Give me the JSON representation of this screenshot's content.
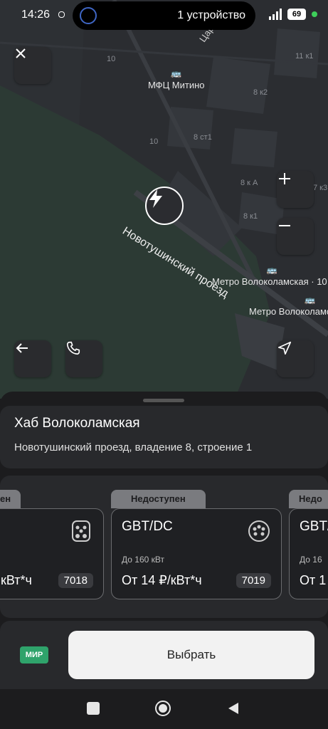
{
  "status_bar": {
    "time": "14:26",
    "device_text": "1 устройство",
    "battery": "69"
  },
  "map": {
    "labels": [
      "Цар",
      "10",
      "11 к1",
      "8 к2",
      "8 ст1",
      "10",
      "8 к А",
      "8 к1",
      "7 к3"
    ],
    "street_name": "Новотушинский проезд",
    "pois": [
      {
        "name": "МФЦ Митино"
      },
      {
        "name": "Метро Волоколамская · 10"
      },
      {
        "name": "Метро Волоколамская"
      }
    ]
  },
  "station": {
    "title": "Хаб Волоколамская",
    "address": "Новотушинский проезд, владение 8, строение 1"
  },
  "connectors": [
    {
      "status": "ен",
      "type": "",
      "power": "",
      "price": "кВт*ч",
      "id": "7018"
    },
    {
      "status": "Недоступен",
      "type": "GBT/DC",
      "power": "До 160 кВт",
      "price": "От 14 ₽/кВт*ч",
      "id": "7019"
    },
    {
      "status": "Недо",
      "type": "GBT/",
      "power": "До 16",
      "price": "От 1",
      "id": ""
    }
  ],
  "payment": {
    "card_label": "МИР",
    "select_label": "Выбрать"
  },
  "colors": {
    "accent": "#2fa36b",
    "sheet": "#28292c",
    "map": "#2b2d31",
    "park": "#2c3a34"
  }
}
